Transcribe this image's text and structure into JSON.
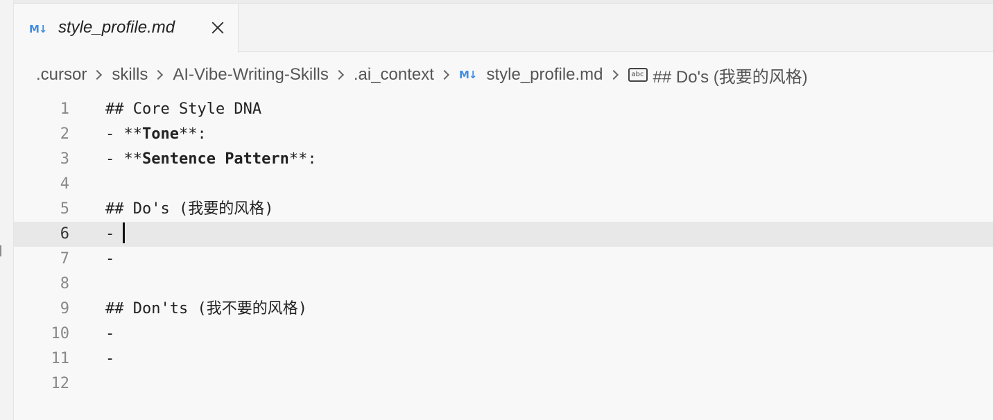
{
  "tab": {
    "icon": "M↓",
    "title": "style_profile.md"
  },
  "breadcrumb": {
    "items": [
      ".cursor",
      "skills",
      "AI-Vibe-Writing-Skills",
      ".ai_context",
      "style_profile.md",
      "## Do's (我要的风格)"
    ],
    "file_icon": "M↓",
    "symbol_icon_text": "abc"
  },
  "editor": {
    "current_line": 6,
    "lines": [
      {
        "num": "1",
        "parts": [
          {
            "text": "## Core Style DNA"
          }
        ]
      },
      {
        "num": "2",
        "parts": [
          {
            "text": "- **"
          },
          {
            "text": "Tone",
            "bold": true
          },
          {
            "text": "**:"
          }
        ]
      },
      {
        "num": "3",
        "parts": [
          {
            "text": "- **"
          },
          {
            "text": "Sentence Pattern",
            "bold": true
          },
          {
            "text": "**:"
          }
        ]
      },
      {
        "num": "4",
        "parts": [
          {
            "text": ""
          }
        ]
      },
      {
        "num": "5",
        "parts": [
          {
            "text": "## Do's (我要的风格)"
          }
        ]
      },
      {
        "num": "6",
        "parts": [
          {
            "text": "-"
          }
        ]
      },
      {
        "num": "7",
        "parts": [
          {
            "text": "-"
          }
        ]
      },
      {
        "num": "8",
        "parts": [
          {
            "text": ""
          }
        ]
      },
      {
        "num": "9",
        "parts": [
          {
            "text": "## Don'ts (我不要的风格)"
          }
        ]
      },
      {
        "num": "10",
        "parts": [
          {
            "text": "-"
          }
        ]
      },
      {
        "num": "11",
        "parts": [
          {
            "text": "-"
          }
        ]
      },
      {
        "num": "12",
        "parts": [
          {
            "text": ""
          }
        ]
      }
    ]
  },
  "colors": {
    "md_icon": "#3d8ee6",
    "current_line_bg": "#e8e8e8"
  }
}
